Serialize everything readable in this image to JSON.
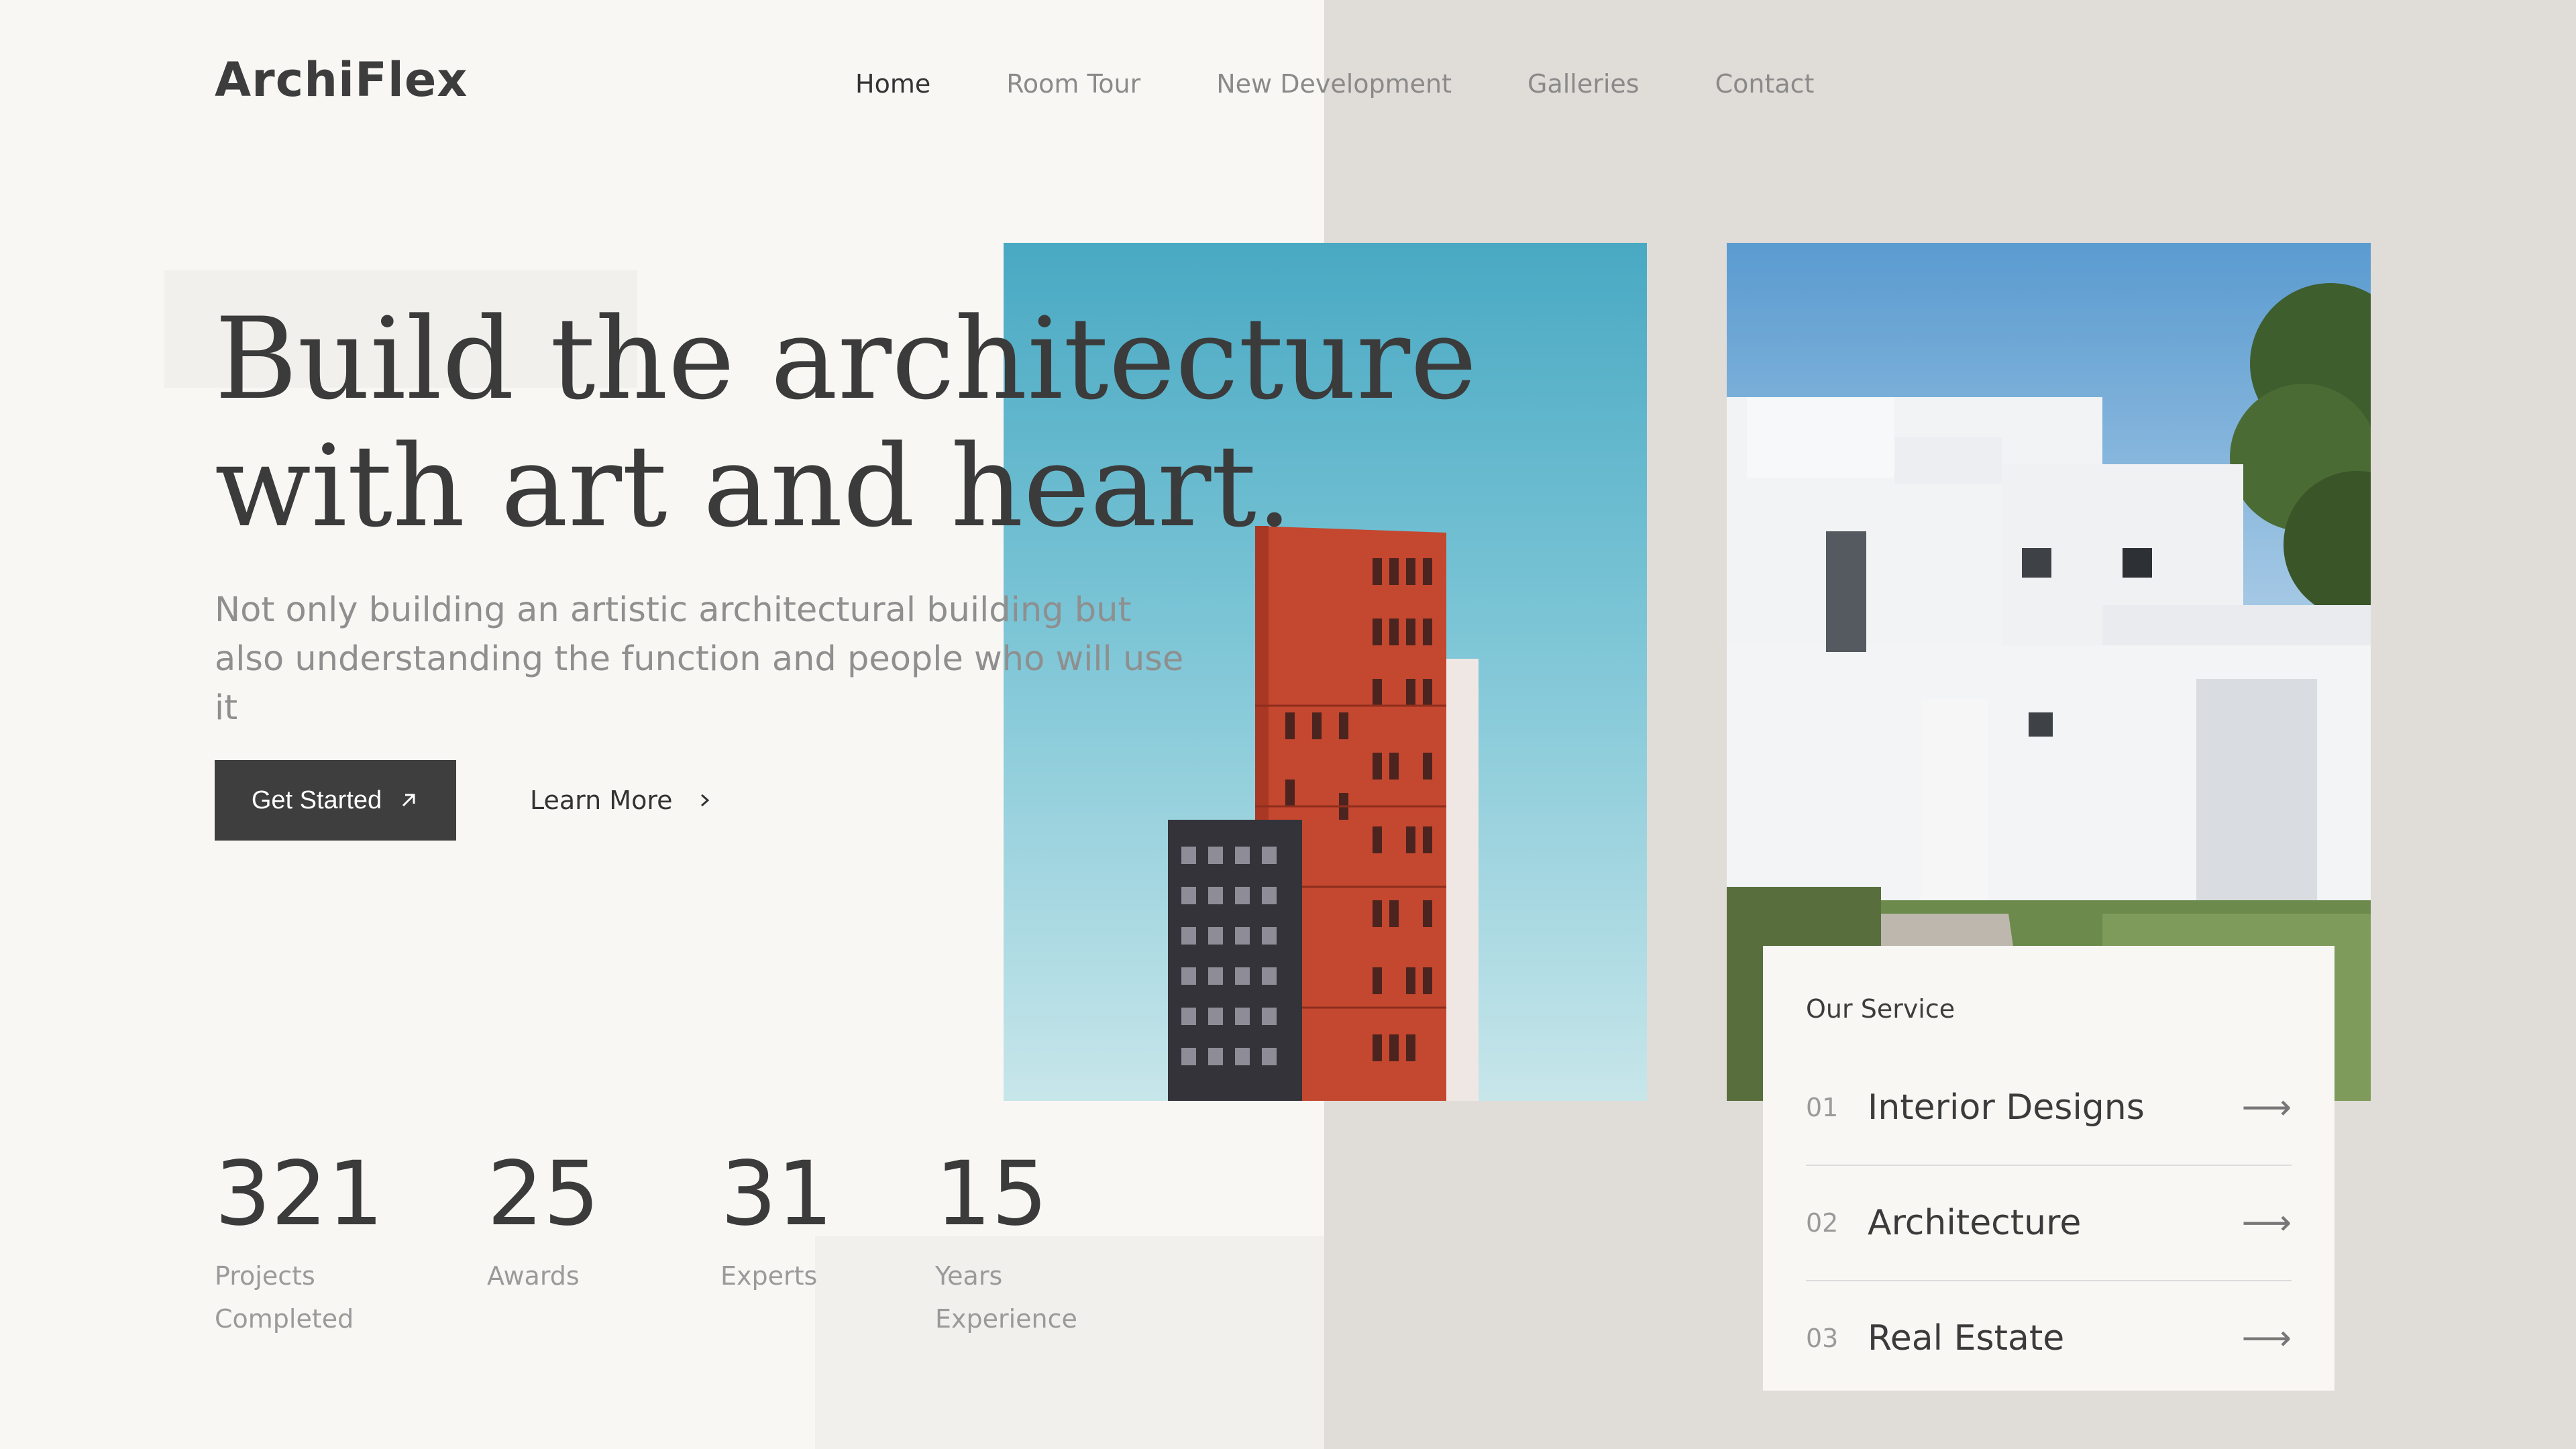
{
  "brand": {
    "logo": "ArchiFlex"
  },
  "nav": {
    "items": [
      {
        "label": "Home",
        "active": true
      },
      {
        "label": "Room Tour",
        "active": false
      },
      {
        "label": "New Development",
        "active": false
      },
      {
        "label": "Galleries",
        "active": false
      },
      {
        "label": "Contact",
        "active": false
      }
    ]
  },
  "hero": {
    "headline_line1": "Build the architecture",
    "headline_line2": "with art and heart.",
    "subtitle": "Not only building an artistic architectural building but also understanding the function and people who will use it",
    "primary_cta": "Get Started",
    "primary_cta_icon": "arrow-up-right-icon",
    "secondary_cta": "Learn More",
    "secondary_cta_icon": "chevron-right-icon"
  },
  "stats": [
    {
      "value": "321",
      "label": "Projects\nCompleted"
    },
    {
      "value": "25",
      "label": "Awards"
    },
    {
      "value": "31",
      "label": "Experts"
    },
    {
      "value": "15",
      "label": "Years\nExperience"
    }
  ],
  "services": {
    "title": "Our Service",
    "items": [
      {
        "index": "01",
        "name": "Interior Designs",
        "icon": "arrow-right-icon"
      },
      {
        "index": "02",
        "name": "Architecture",
        "icon": "arrow-right-icon"
      },
      {
        "index": "03",
        "name": "Real Estate",
        "icon": "arrow-right-icon"
      }
    ]
  },
  "colors": {
    "background": "#f8f7f4",
    "panel": "#e0ddd8",
    "text_dark": "#3b3b3b",
    "text_muted": "#8f8f8f",
    "button": "#3e3e3e",
    "sky": "#49a9c3",
    "tower_red": "#c4472f"
  }
}
